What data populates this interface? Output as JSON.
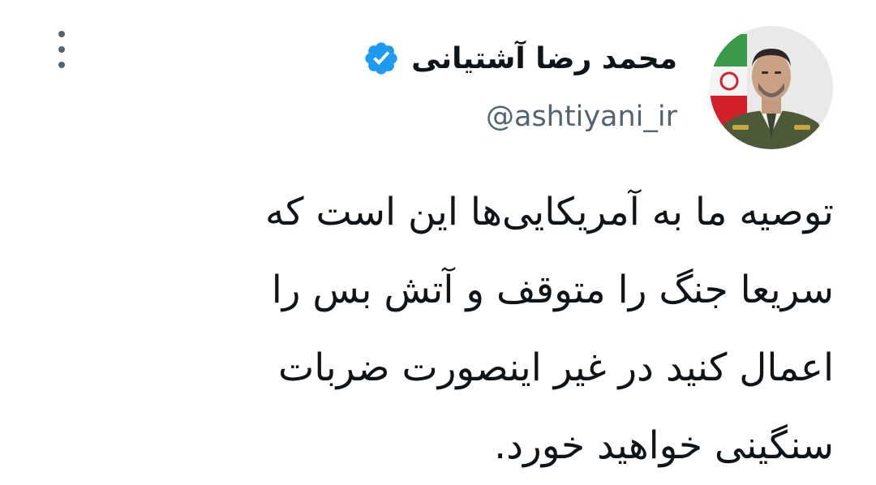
{
  "author": {
    "display_name": "محمد رضا آشتیانی",
    "handle": "@ashtiyani_ir",
    "verified": true,
    "verified_color": "#1d9bf0"
  },
  "tweet": {
    "lines": [
      "توصیه ما به آمریکایی‌ها این است که",
      "سریعا جنگ را متوقف و آتش بس را",
      "اعمال کنید در غیر اینصورت ضربات",
      "سنگینی خواهید خورد."
    ]
  },
  "icons": {
    "more": "more-vertical-icon",
    "verified": "verified-badge-icon"
  },
  "colors": {
    "text": "#0f1419",
    "secondary": "#536471",
    "accent": "#1d9bf0"
  }
}
